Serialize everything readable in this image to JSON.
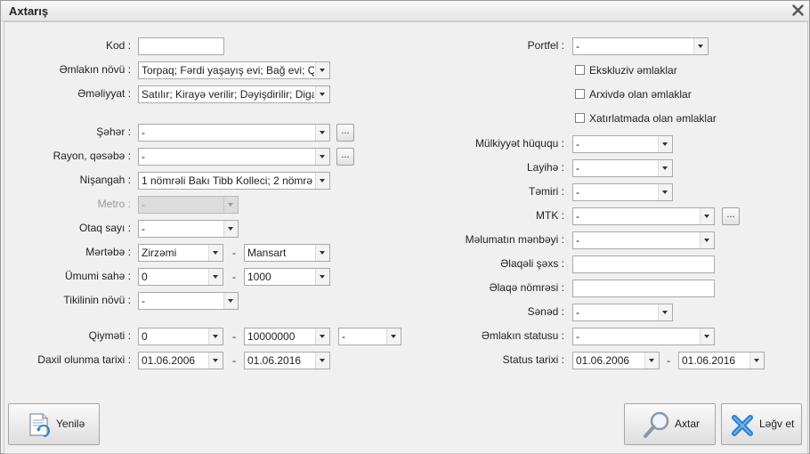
{
  "window": {
    "title": "Axtarış"
  },
  "left": {
    "kod_label": "Kod :",
    "emlak_novu_label": "Əmlakın növü :",
    "emlak_novu_value": "Torpaq; Fərdi yaşayış evi; Bağ evi; Qa",
    "emeliyyat_label": "Əməliyyat :",
    "emeliyyat_value": "Satılır; Kirayə verilir; Dəyişdirilir; Diga",
    "seher_label": "Şəhər :",
    "seher_value": "-",
    "rayon_label": "Rayon, qəsəbə :",
    "rayon_value": "-",
    "nisangah_label": "Nişangah :",
    "nisangah_value": "1 nömrəli Bakı Tibb Kolleci; 2 nömrə",
    "metro_label": "Metro :",
    "metro_value": "-",
    "otaq_label": "Otaq sayı :",
    "otaq_value": "-",
    "mertebe_label": "Mərtəbə :",
    "mertebe_from": "Zirzəmi",
    "mertebe_to": "Mansart",
    "sahe_label": "Ümumi sahə :",
    "sahe_from": "0",
    "sahe_to": "1000",
    "tikili_label": "Tikilinin növü :",
    "tikili_value": "-",
    "qiymet_label": "Qiyməti :",
    "qiymet_from": "0",
    "qiymet_to": "10000000",
    "qiymet_currency": "-",
    "daxil_label": "Daxil olunma tarixi :",
    "daxil_from": "01.06.2006",
    "daxil_to": "01.06.2016",
    "range_dash": "-",
    "dots": "..."
  },
  "right": {
    "portfel_label": "Portfel :",
    "portfel_value": "-",
    "ekskluziv": "Ekskluziv əmlaklar",
    "arxiv": "Arxivdə olan əmlaklar",
    "xatirlatma": "Xatırlatmada olan əmlaklar",
    "mulkiyyet_label": "Mülkiyyət hüququ :",
    "mulkiyyet_value": "-",
    "layihe_label": "Layihə :",
    "layihe_value": "-",
    "temiri_label": "Təmiri :",
    "temiri_value": "-",
    "mtk_label": "MTK :",
    "mtk_value": "-",
    "menbe_label": "Məlumatın mənbəyi :",
    "menbe_value": "-",
    "elaqeli_label": "Əlaqəli şəxs :",
    "elaqe_nomre_label": "Əlaqə nömrəsi :",
    "sened_label": "Sənəd :",
    "sened_value": "-",
    "status_label": "Əmlakın statusu :",
    "status_value": "-",
    "status_tarixi_label": "Status tarixi :",
    "status_from": "01.06.2006",
    "status_to": "01.06.2016"
  },
  "buttons": {
    "yenile": "Yenilə",
    "axtar": "Axtar",
    "legv": "Ləğv et"
  }
}
